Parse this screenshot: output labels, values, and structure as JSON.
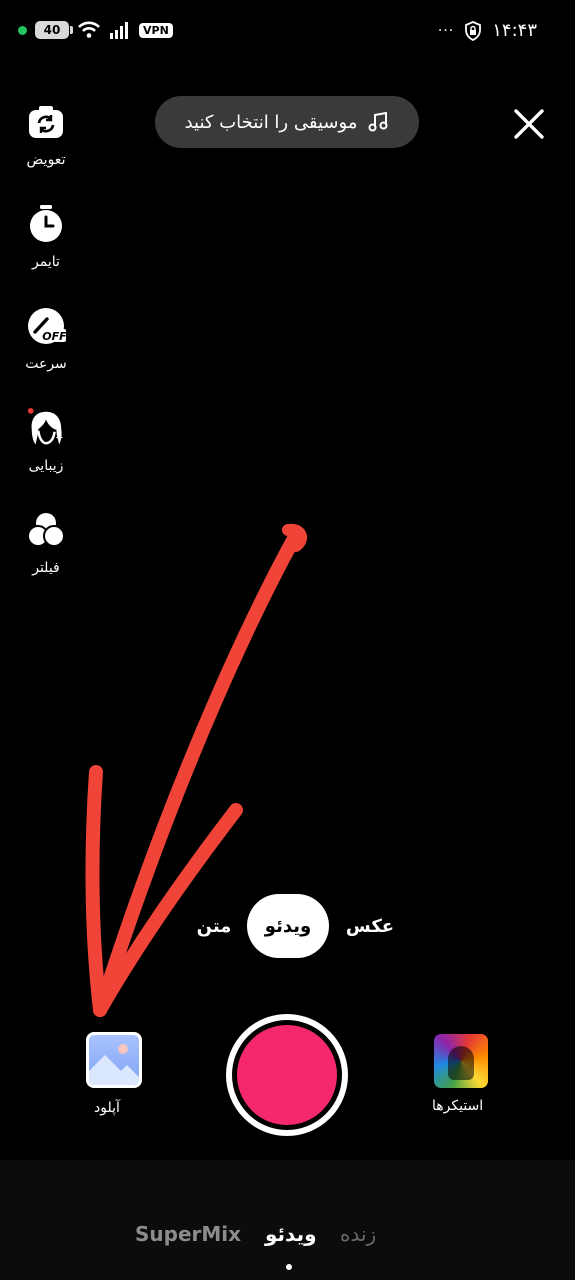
{
  "status_bar": {
    "battery": "40",
    "vpn": "VPN",
    "time": "۱۴:۴۳",
    "more": "···"
  },
  "top": {
    "music_label": "موسیقی را انتخاب کنید",
    "close_icon": "close-icon",
    "music_icon": "music-note-icon"
  },
  "side_tools": [
    {
      "label": "تعویض",
      "icon": "flip-camera-icon"
    },
    {
      "label": "تایمر",
      "icon": "timer-icon"
    },
    {
      "label": "سرعت",
      "icon": "speed-icon",
      "badge": "OFF"
    },
    {
      "label": "زیبایی",
      "icon": "beauty-icon"
    },
    {
      "label": "فیلتر",
      "icon": "filter-icon"
    }
  ],
  "modes": {
    "photo": "عکس",
    "video": "ویدئو",
    "text": "متن",
    "active": "video"
  },
  "bottom_controls": {
    "upload_label": "آپلود",
    "stickers_label": "استیکرها",
    "record_color": "#f5286e"
  },
  "bottom_tabs": {
    "live": "زنده",
    "video": "ویدئو",
    "supermix": "SuperMix",
    "active": "video"
  },
  "colors": {
    "accent": "#f5286e",
    "annotation": "#f04438",
    "pill_bg": "#3a3a3a"
  }
}
